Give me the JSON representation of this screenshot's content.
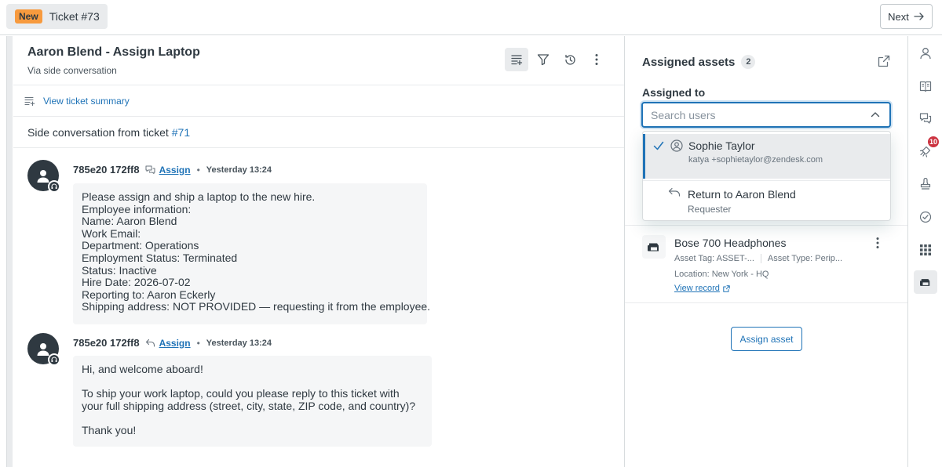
{
  "tab": {
    "badge": "New",
    "title": "Ticket #73"
  },
  "nav": {
    "next_label": "Next"
  },
  "conversation": {
    "title": "Aaron Blend - Assign Laptop",
    "subtitle": "Via side conversation",
    "summary_link": "View ticket summary",
    "side_conversation_prefix": "Side conversation from ticket",
    "side_conversation_ticket": "#71",
    "messages": [
      {
        "author": "785e20 172ff8",
        "via": "Assign",
        "time": "Yesterday 13:24",
        "lines": [
          "Please assign and ship a laptop to the new hire.",
          "Employee information:",
          "Name: Aaron Blend",
          "Work Email:",
          "Department: Operations",
          "Employment Status: Terminated",
          "Status: Inactive",
          "Hire Date: 2026-07-02",
          "Reporting to: Aaron Eckerly",
          "Shipping address: NOT PROVIDED — requesting it from the employee."
        ]
      },
      {
        "author": "785e20 172ff8",
        "via": "Assign",
        "time": "Yesterday 13:24",
        "paragraphs": [
          "Hi, and welcome aboard!",
          "To ship your work laptop, could you please reply to this ticket with your full shipping address (street, city, state, ZIP code, and country)?",
          "Thank you!"
        ]
      }
    ]
  },
  "assets": {
    "title": "Assigned assets",
    "count": "2",
    "assigned_to_label": "Assigned to",
    "search_placeholder": "Search users",
    "dropdown": {
      "selected": {
        "name": "Sophie Taylor",
        "email": "katya                    +sophietaylor@zendesk.com"
      },
      "other": {
        "name": "Return to Aaron Blend",
        "role": "Requester"
      }
    },
    "item": {
      "name": "Bose 700 Headphones",
      "asset_tag": "Asset Tag: ASSET-...",
      "asset_type": "Asset Type: Perip...",
      "location": "Location: New York - HQ",
      "link": "View record"
    },
    "assign_button": "Assign asset"
  },
  "rail": {
    "notification_count": "10"
  },
  "colors": {
    "accent": "#1f73b7",
    "badge_new": "#f79a3e",
    "notification": "#cc3340",
    "text": "#2f3941"
  }
}
